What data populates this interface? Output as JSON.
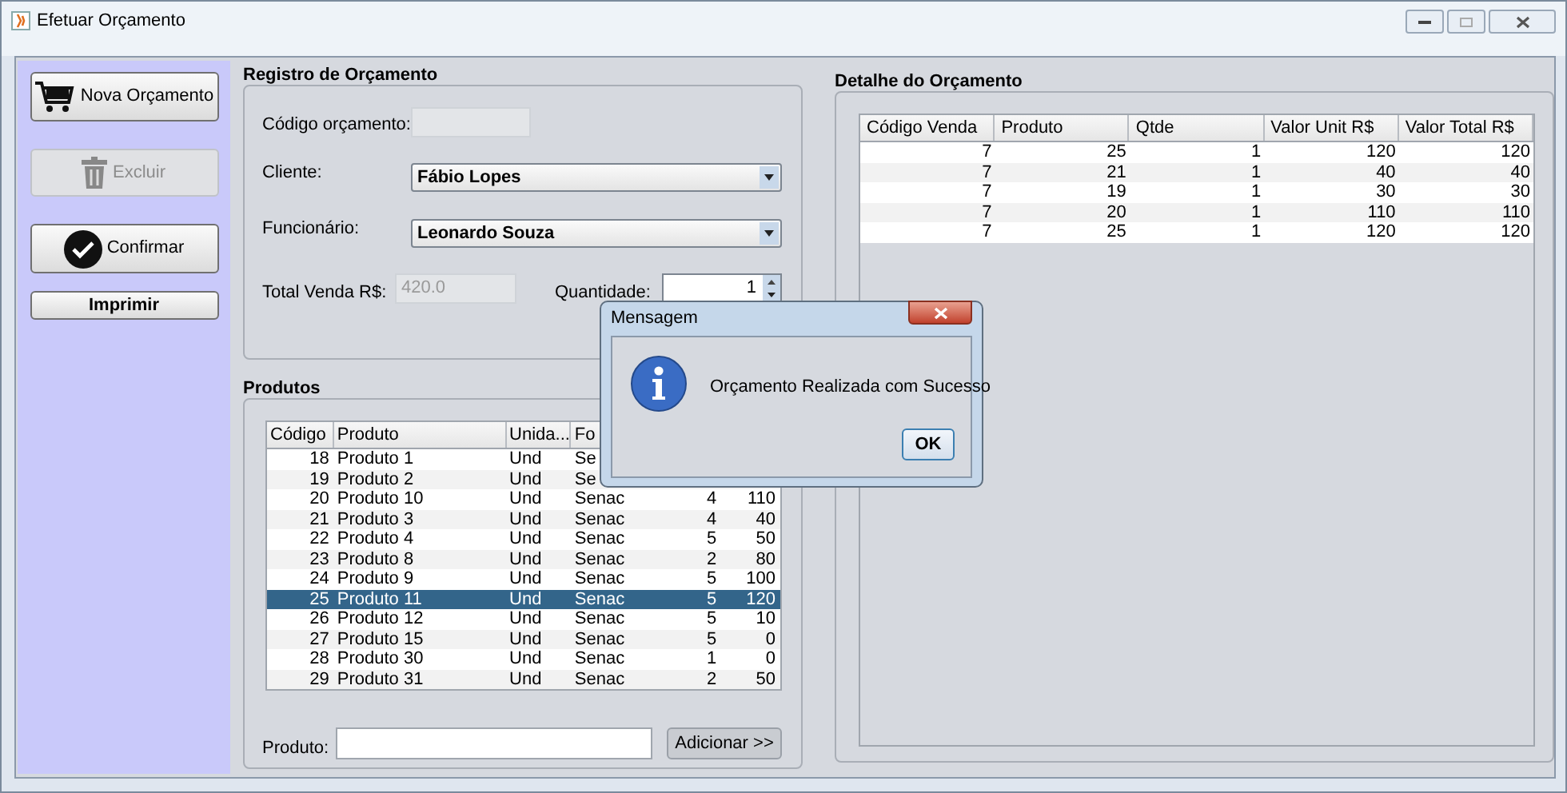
{
  "window": {
    "title": "Efetuar Orçamento"
  },
  "sidebar": {
    "buttons": [
      {
        "label": "Nova Orçamento",
        "kind": "cart",
        "disabled": false
      },
      {
        "label": "Excluir",
        "kind": "trash",
        "disabled": true
      },
      {
        "label": "Confirmar",
        "kind": "check",
        "disabled": false
      },
      {
        "label": "Imprimir",
        "kind": "plain",
        "disabled": false
      }
    ]
  },
  "registro": {
    "title": "Registro de Orçamento",
    "codigo_label": "Código orçamento:",
    "cliente_label": "Cliente:",
    "cliente": "Fábio Lopes",
    "funcionario_label": "Funcionário:",
    "funcionario": "Leonardo Souza",
    "total_label": "Total Venda R$:",
    "total": "420.0",
    "quantidade_label": "Quantidade:",
    "quantidade": "1"
  },
  "produtos": {
    "title": "Produtos",
    "columns": [
      "Código",
      "Produto",
      "Unida...",
      "Fo"
    ],
    "rows": [
      {
        "cells": [
          "18",
          "Produto 1",
          "Und",
          "Se"
        ],
        "selected": false
      },
      {
        "cells": [
          "19",
          "Produto 2",
          "Und",
          "Se"
        ],
        "selected": false
      },
      {
        "cells": [
          "20",
          "Produto 10",
          "Und",
          "Senac",
          "4",
          "110"
        ],
        "selected": false
      },
      {
        "cells": [
          "21",
          "Produto 3",
          "Und",
          "Senac",
          "4",
          "40"
        ],
        "selected": false
      },
      {
        "cells": [
          "22",
          "Produto 4",
          "Und",
          "Senac",
          "5",
          "50"
        ],
        "selected": false
      },
      {
        "cells": [
          "23",
          "Produto 8",
          "Und",
          "Senac",
          "2",
          "80"
        ],
        "selected": false
      },
      {
        "cells": [
          "24",
          "Produto 9",
          "Und",
          "Senac",
          "5",
          "100"
        ],
        "selected": false
      },
      {
        "cells": [
          "25",
          "Produto 11",
          "Und",
          "Senac",
          "5",
          "120"
        ],
        "selected": true
      },
      {
        "cells": [
          "26",
          "Produto 12",
          "Und",
          "Senac",
          "5",
          "10"
        ],
        "selected": false
      },
      {
        "cells": [
          "27",
          "Produto 15",
          "Und",
          "Senac",
          "5",
          "0"
        ],
        "selected": false
      },
      {
        "cells": [
          "28",
          "Produto 30",
          "Und",
          "Senac",
          "1",
          "0"
        ],
        "selected": false
      },
      {
        "cells": [
          "29",
          "Produto 31",
          "Und",
          "Senac",
          "2",
          "50"
        ],
        "selected": false
      }
    ],
    "produto_label": "Produto:",
    "add_button": "Adicionar >>"
  },
  "detalhe": {
    "title": "Detalhe do Orçamento",
    "columns": [
      "Código Venda",
      "Produto",
      "Qtde",
      "Valor Unit R$",
      "Valor Total R$"
    ],
    "rows": [
      [
        "7",
        "25",
        "1",
        "120",
        "120"
      ],
      [
        "7",
        "21",
        "1",
        "40",
        "40"
      ],
      [
        "7",
        "19",
        "1",
        "30",
        "30"
      ],
      [
        "7",
        "20",
        "1",
        "110",
        "110"
      ],
      [
        "7",
        "25",
        "1",
        "120",
        "120"
      ]
    ]
  },
  "dialog": {
    "title": "Mensagem",
    "message": "Orçamento Realizada com Sucesso",
    "button": "OK"
  }
}
